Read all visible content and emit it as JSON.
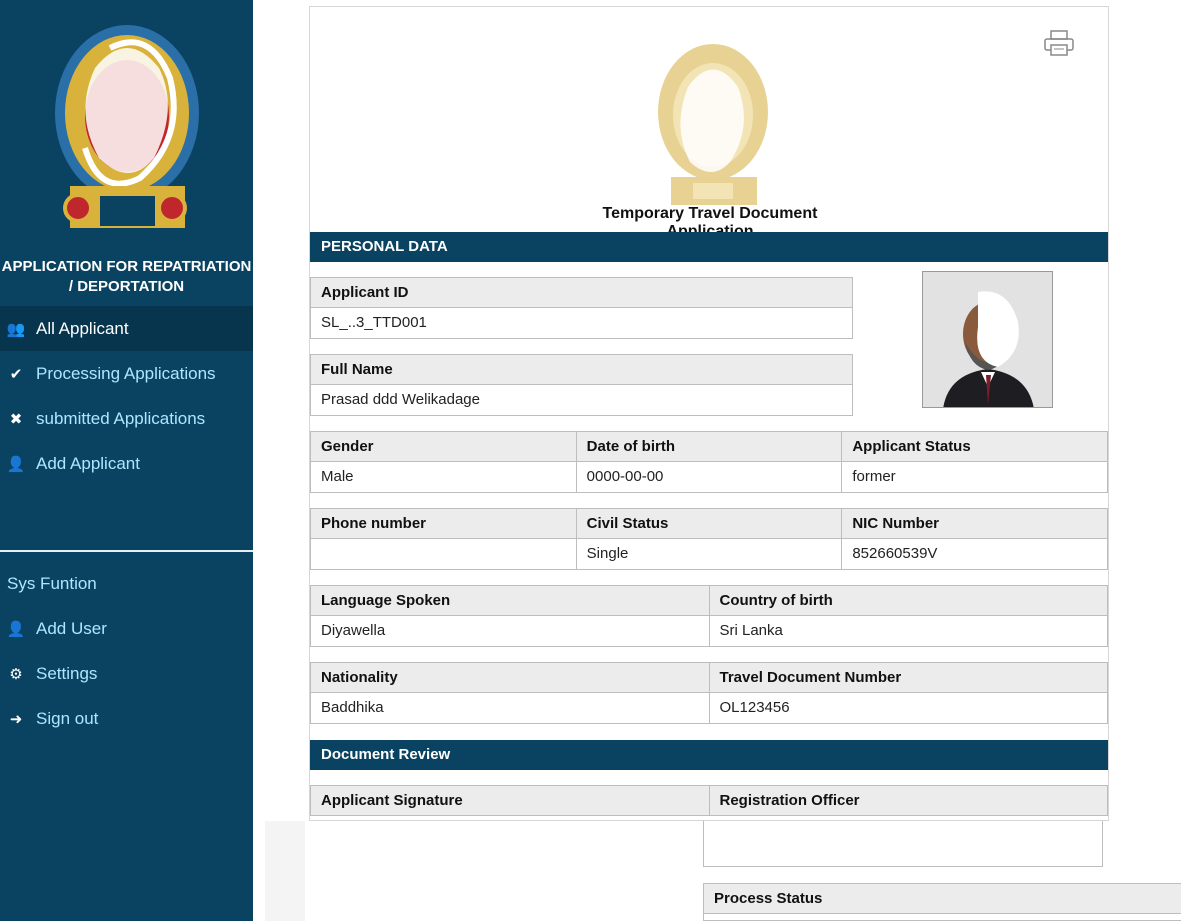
{
  "sidebar": {
    "app_title": "APPLICATION FOR REPATRIATION / DEPORTATION",
    "nav": [
      {
        "label": "All Applicant",
        "icon": "users-icon",
        "active": true
      },
      {
        "label": "Processing Applications",
        "icon": "check-icon",
        "active": false
      },
      {
        "label": "submitted Applications",
        "icon": "close-icon",
        "active": false
      },
      {
        "label": "Add Applicant",
        "icon": "user-plus-icon",
        "active": false
      }
    ],
    "section_label": "Sys Funtion",
    "nav2": [
      {
        "label": "Add User",
        "icon": "user-icon"
      },
      {
        "label": "Settings",
        "icon": "gear-icon"
      },
      {
        "label": "Sign out",
        "icon": "sign-out-icon"
      }
    ]
  },
  "document": {
    "title": "Temporary Travel Document Application",
    "personal_header": "PERSONAL DATA",
    "applicant_id": {
      "label": "Applicant ID",
      "value": "SL_..3_TTD001"
    },
    "full_name": {
      "label": "Full Name",
      "value": "Prasad ddd Welikadage"
    },
    "row1": [
      {
        "label": "Gender",
        "value": "Male"
      },
      {
        "label": "Date of birth",
        "value": "0000-00-00"
      },
      {
        "label": "Applicant Status",
        "value": "former"
      }
    ],
    "row2": [
      {
        "label": "Phone number",
        "value": ""
      },
      {
        "label": "Civil Status",
        "value": "Single"
      },
      {
        "label": "NIC Number",
        "value": "852660539V"
      }
    ],
    "row3": [
      {
        "label": "Language Spoken",
        "value": "Diyawella"
      },
      {
        "label": "Country of birth",
        "value": "Sri Lanka"
      }
    ],
    "row4": [
      {
        "label": "Nationality",
        "value": "Baddhika"
      },
      {
        "label": "Travel Document Number",
        "value": "OL123456"
      }
    ],
    "review_header": "Document Review",
    "row5": [
      {
        "label": "Applicant Signature",
        "value": ""
      },
      {
        "label": "Registration Officer",
        "value": ""
      }
    ],
    "process_status": "Process Status"
  },
  "colors": {
    "sidebar_bg": "#0a4362",
    "nav_text": "#aee6ff",
    "header_bar": "#0a4362"
  }
}
